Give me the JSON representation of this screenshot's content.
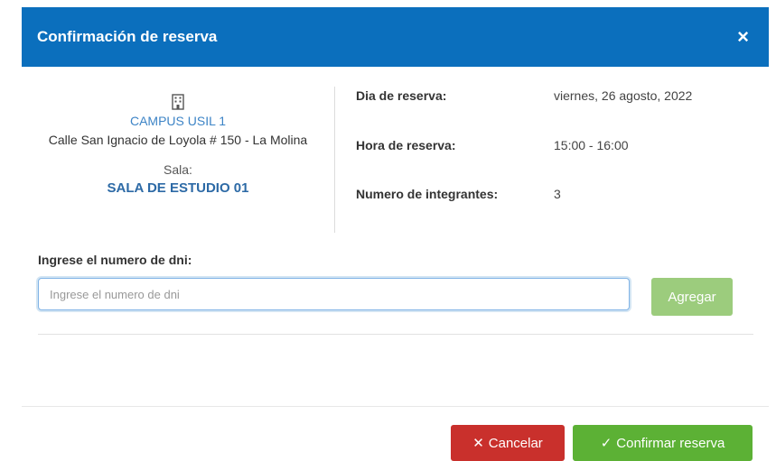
{
  "modal": {
    "title": "Confirmación de reserva",
    "close_icon": "×"
  },
  "location": {
    "icon": "building-icon",
    "campus": "CAMPUS USIL 1",
    "address": "Calle San Ignacio de Loyola # 150 - La Molina",
    "sala_label": "Sala:",
    "sala_name": "SALA DE ESTUDIO 01"
  },
  "details": [
    {
      "label": "Dia de reserva:",
      "value": "viernes, 26 agosto, 2022"
    },
    {
      "label": "Hora de reserva:",
      "value": "15:00 - 16:00"
    },
    {
      "label": "Numero de integrantes:",
      "value": "3"
    }
  ],
  "dni": {
    "label": "Ingrese el numero de dni:",
    "value": "",
    "placeholder": "Ingrese el numero de dni",
    "add_label": "Agregar"
  },
  "footer": {
    "cancel_icon": "✕",
    "cancel_label": "Cancelar",
    "confirm_icon": "✓",
    "confirm_label": "Confirmar reserva"
  },
  "colors": {
    "header": "#0b6fbd",
    "cancel": "#c9302c",
    "confirm": "#5cb135",
    "add": "#9ccc7d"
  }
}
